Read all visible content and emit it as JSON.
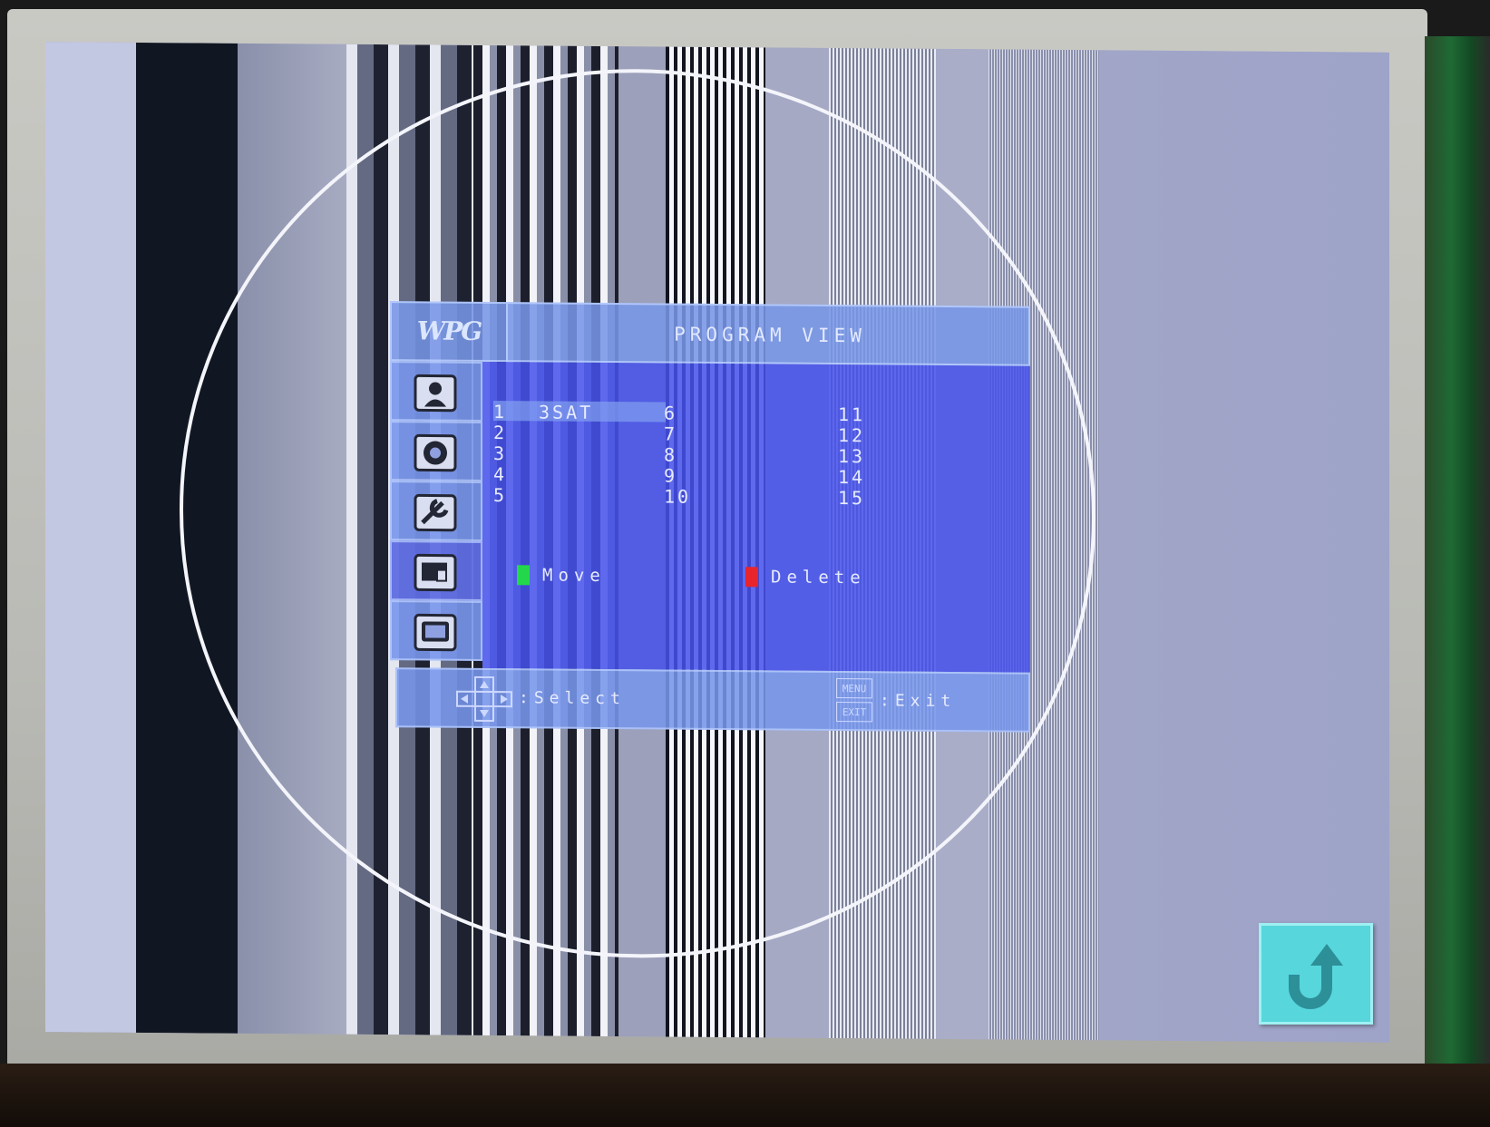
{
  "osd": {
    "logo": "WPG",
    "title": "PROGRAM VIEW",
    "sidebar_icons": [
      "picture-settings-icon",
      "sound-settings-icon",
      "tools-settings-icon",
      "program-view-icon",
      "tv-channel-icon"
    ],
    "programs": [
      {
        "col1_num": "1",
        "col1_name": "3SAT",
        "col2_num": "6",
        "col3_num": "11"
      },
      {
        "col1_num": "2",
        "col1_name": "",
        "col2_num": "7",
        "col3_num": "12"
      },
      {
        "col1_num": "3",
        "col1_name": "",
        "col2_num": "8",
        "col3_num": "13"
      },
      {
        "col1_num": "4",
        "col1_name": "",
        "col2_num": "9",
        "col3_num": "14"
      },
      {
        "col1_num": "5",
        "col1_name": "",
        "col2_num": "10",
        "col3_num": "15"
      }
    ],
    "keys": {
      "move_label": "Move",
      "move_color": "#22d84a",
      "delete_label": "Delete",
      "delete_color": "#e8242c"
    },
    "footer": {
      "select_label": ":Select",
      "menu_key": "MENU",
      "exit_key": "EXIT",
      "exit_label": ":Exit"
    }
  },
  "overlay": {
    "return_icon": "u-turn-arrow-icon",
    "return_color": "#57d6dc"
  }
}
